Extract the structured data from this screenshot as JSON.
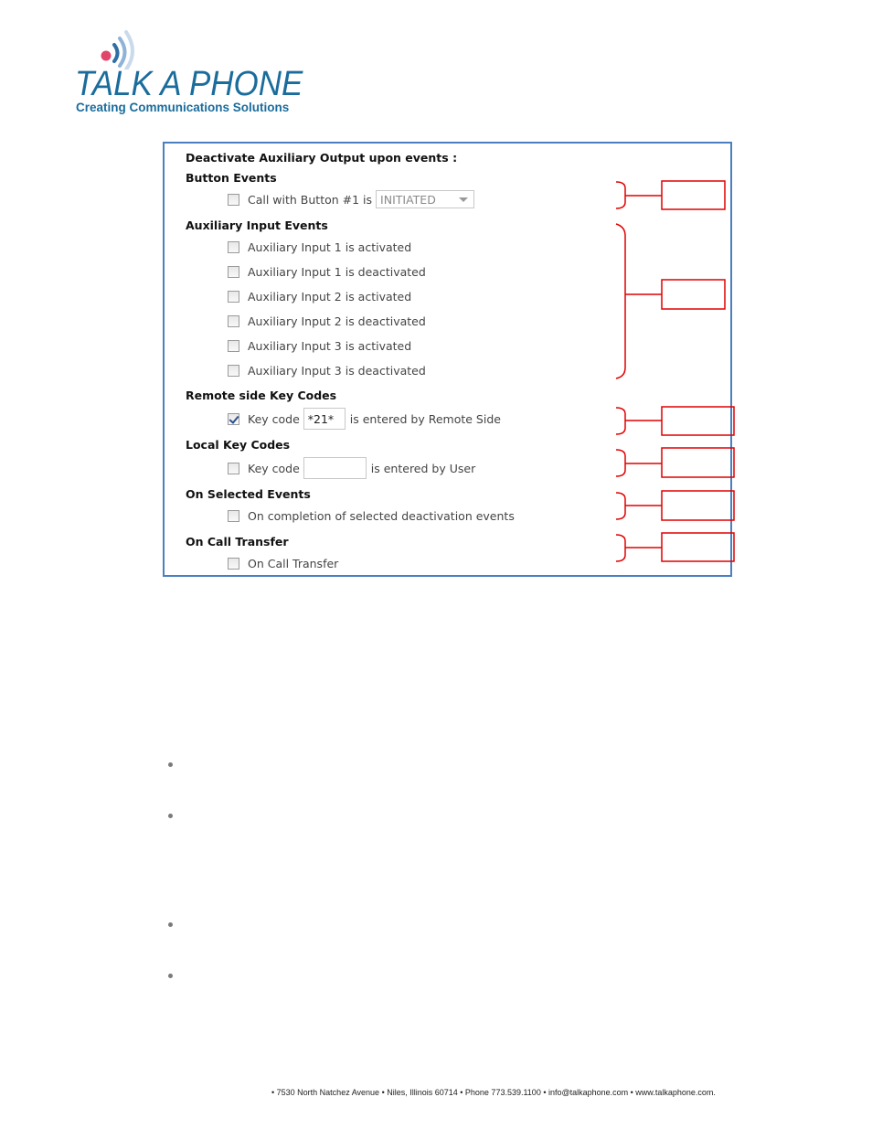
{
  "logo": {
    "title": "TALK A PHONE",
    "tagline": "Creating Communications Solutions",
    "brand_color": "#1a6c9c",
    "dot_color": "#e2456a"
  },
  "panel": {
    "title": "Deactivate Auxiliary Output upon events :",
    "border_color": "#4a7fc0",
    "sections": {
      "button_events": {
        "title": "Button Events",
        "row": {
          "prefix": "Call with Button #1 is",
          "checked": false,
          "select_value": "INITIATED"
        }
      },
      "aux_input_events": {
        "title": "Auxiliary Input Events",
        "items": [
          {
            "label": "Auxiliary Input 1 is activated",
            "checked": false
          },
          {
            "label": "Auxiliary Input 1 is deactivated",
            "checked": false
          },
          {
            "label": "Auxiliary Input 2 is activated",
            "checked": false
          },
          {
            "label": "Auxiliary Input 2 is deactivated",
            "checked": false
          },
          {
            "label": "Auxiliary Input 3 is activated",
            "checked": false
          },
          {
            "label": "Auxiliary Input 3 is deactivated",
            "checked": false
          }
        ]
      },
      "remote_key_codes": {
        "title": "Remote side Key Codes",
        "row": {
          "prefix": "Key code",
          "value": "*21*",
          "suffix": "is entered by Remote Side",
          "checked": true
        }
      },
      "local_key_codes": {
        "title": "Local Key Codes",
        "row": {
          "prefix": "Key code",
          "value": "",
          "suffix": "is entered by User",
          "checked": false
        }
      },
      "on_selected_events": {
        "title": "On Selected Events",
        "row": {
          "label": "On completion of selected deactivation events",
          "checked": false
        }
      },
      "on_call_transfer": {
        "title": "On Call Transfer",
        "row": {
          "label": "On Call Transfer",
          "checked": false
        }
      }
    }
  },
  "annotation_color": "#e00000",
  "bullets_count": 4,
  "footer": {
    "text": "• 7530 North Natchez Avenue • Niles, Illinois 60714 • Phone 773.539.1100 • info@talkaphone.com • www.talkaphone.com."
  }
}
